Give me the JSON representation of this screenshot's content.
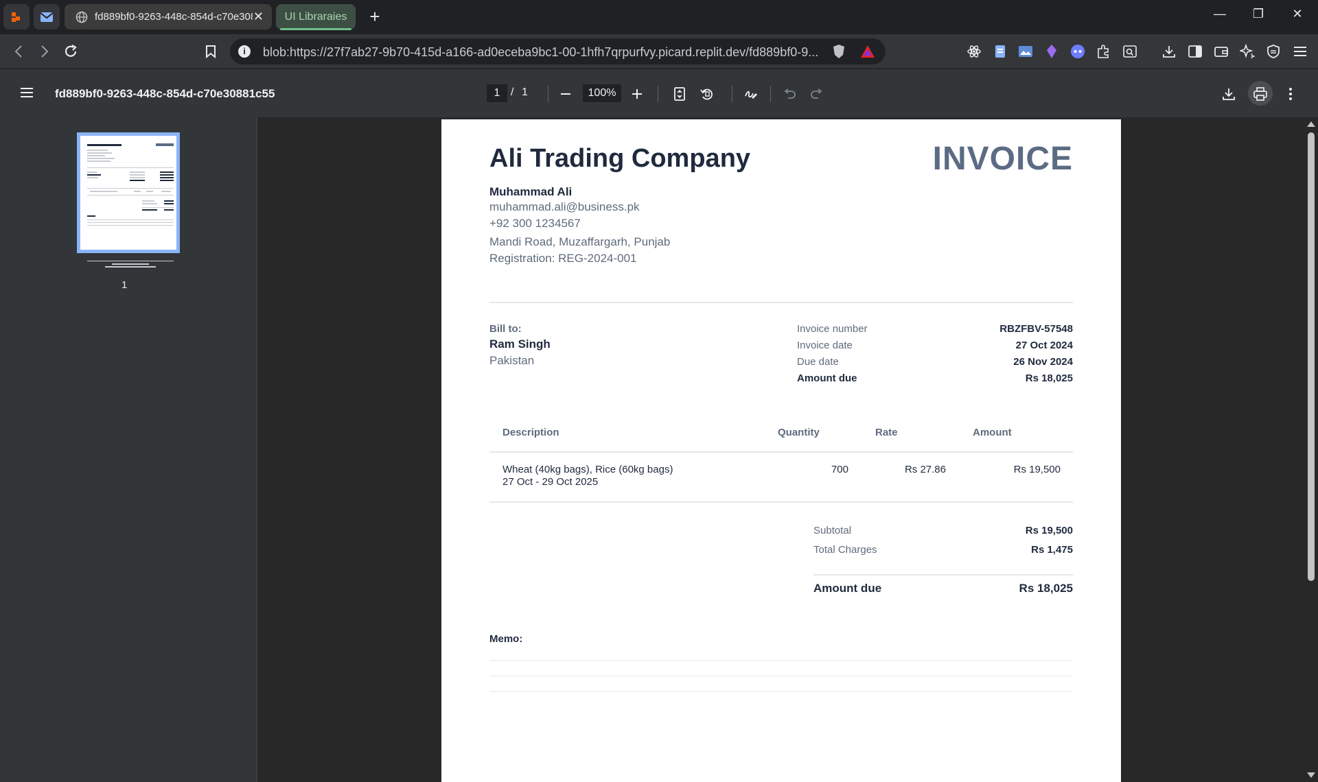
{
  "browser": {
    "active_tab_title": "fd889bf0-9263-448c-854d-c70e30881c55",
    "group_tab_label": "UI Libraraies",
    "url": "blob:https://27f7ab27-9b70-415d-a166-ad0eceba9bc1-00-1hfh7qrpurfvy.picard.replit.dev/fd889bf0-9..."
  },
  "pdf_toolbar": {
    "document_name": "fd889bf0-9263-448c-854d-c70e30881c55",
    "current_page": "1",
    "page_separator": "/",
    "total_pages": "1",
    "zoom": "100%"
  },
  "sidebar": {
    "thumbnail_page_number": "1"
  },
  "invoice": {
    "company": "Ali Trading Company",
    "title": "INVOICE",
    "owner_name": "Muhammad Ali",
    "email": "muhammad.ali@business.pk",
    "phone": "+92 300 1234567",
    "address": "Mandi Road, Muzaffargarh, Punjab",
    "registration": "Registration: REG-2024-001",
    "bill_to_label": "Bill to:",
    "client_name": "Ram Singh",
    "client_country": "Pakistan",
    "meta": [
      {
        "label": "Invoice number",
        "value": "RBZFBV-57548"
      },
      {
        "label": "Invoice date",
        "value": "27 Oct 2024"
      },
      {
        "label": "Due date",
        "value": "26 Nov 2024"
      },
      {
        "label": "Amount due",
        "value": "Rs 18,025"
      }
    ],
    "columns": {
      "description": "Description",
      "quantity": "Quantity",
      "rate": "Rate",
      "amount": "Amount"
    },
    "items": [
      {
        "description": "Wheat (40kg bags), Rice (60kg bags)",
        "period": "27 Oct - 29 Oct 2025",
        "quantity": "700",
        "rate": "Rs 27.86",
        "amount": "Rs 19,500"
      }
    ],
    "subtotal_label": "Subtotal",
    "subtotal_value": "Rs 19,500",
    "charges_label": "Total Charges",
    "charges_value": "Rs 1,475",
    "amount_due_label": "Amount due",
    "amount_due_value": "Rs 18,025",
    "memo_label": "Memo:"
  },
  "colors": {
    "accent": "#8ab4f8",
    "invoice_title": "#5b6b84",
    "tab_group": "#6ec08a"
  }
}
